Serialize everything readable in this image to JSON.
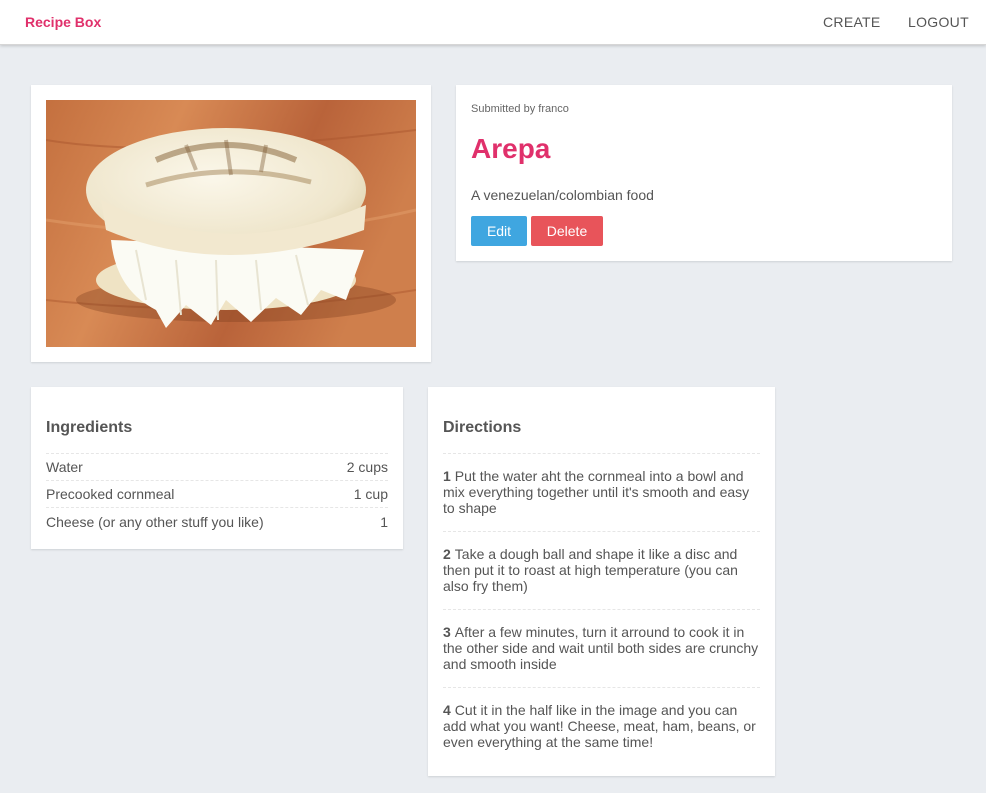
{
  "nav": {
    "brand": "Recipe Box",
    "create": "CREATE",
    "logout": "LOGOUT",
    "brand_color": "#e0306b"
  },
  "recipe": {
    "submitted_by": "Submitted by franco",
    "title": "Arepa",
    "description": "A venezuelan/colombian food",
    "image_subject": "arepa-with-cheese-photo"
  },
  "actions": {
    "edit": "Edit",
    "delete": "Delete",
    "edit_color": "#3fa6e0",
    "delete_color": "#e8545a"
  },
  "ingredients": {
    "title": "Ingredients",
    "items": [
      {
        "name": "Water",
        "qty": "2 cups"
      },
      {
        "name": "Precooked cornmeal",
        "qty": "1 cup"
      },
      {
        "name": "Cheese (or any other stuff you like)",
        "qty": "1"
      }
    ]
  },
  "directions": {
    "title": "Directions",
    "steps": [
      {
        "num": "1",
        "text": "Put the water aht the cornmeal into a bowl and mix everything together until it's smooth and easy to shape"
      },
      {
        "num": "2",
        "text": "Take a dough ball and shape it like a disc and then put it to roast at high temperature (you can also fry them)"
      },
      {
        "num": "3",
        "text": "After a few minutes, turn it arround to cook it in the other side and wait until both sides are crunchy and smooth inside"
      },
      {
        "num": "4",
        "text": "Cut it in the half like in the image and you can add what you want! Cheese, meat, ham, beans, or even everything at the same time!"
      }
    ]
  }
}
